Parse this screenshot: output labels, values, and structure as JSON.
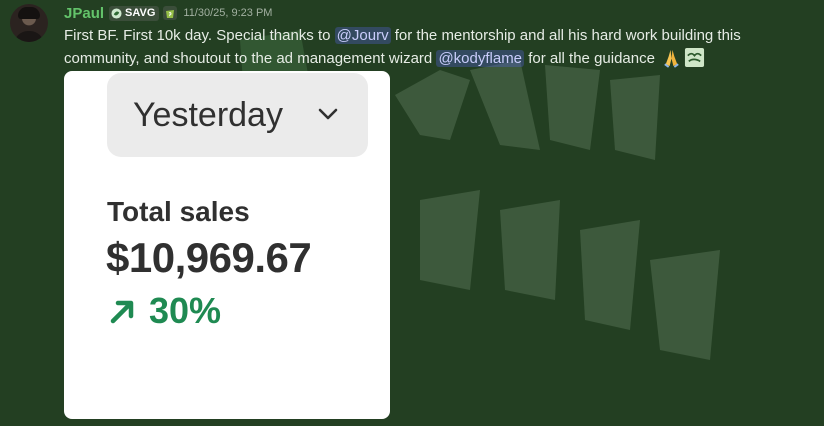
{
  "post": {
    "username": "JPaul",
    "tag": "SAVG",
    "timestamp": "11/30/25, 9:23 PM",
    "text_1": "First BF. First 10k day. Special thanks to ",
    "mention_1": "@Jourv",
    "text_2": " for the mentorship and all his hard work building this community, and shoutout to the ad management wizard ",
    "mention_2": "@kodyflame",
    "text_3": " for all the guidance ",
    "emojis": [
      "folded-hands-icon",
      "custom-sticker-icon"
    ]
  },
  "attachment": {
    "dropdown_value": "Yesterday",
    "total_label": "Total sales",
    "total_value": "$10,969.67",
    "change_value": "30%",
    "change_direction": "up",
    "accent_color": "#1f8a52"
  },
  "colors": {
    "background": "#233f22",
    "username": "#63c36a",
    "mention_bg": "#4b5596"
  }
}
